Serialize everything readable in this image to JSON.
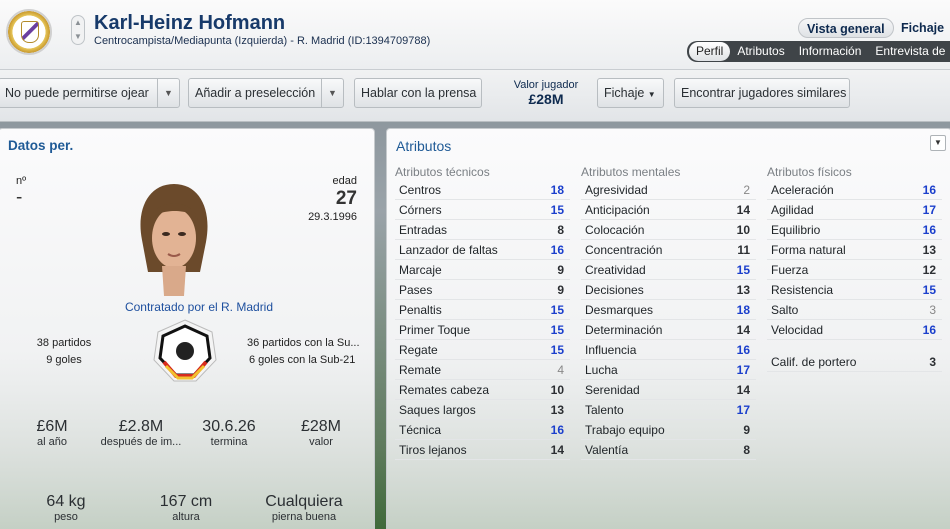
{
  "header": {
    "name": "Karl-Heinz Hofmann",
    "info": "Centrocampista/Mediapunta (Izquierda) - R. Madrid (ID:1394709788)",
    "views": [
      "Vista general",
      "Fichaje"
    ],
    "tabs": [
      "Perfil",
      "Atributos",
      "Información",
      "Entrevista de"
    ]
  },
  "toolbar": {
    "scout": "No puede permitirse ojear",
    "shortlist": "Añadir a preselección",
    "press": "Hablar con la prensa",
    "value_label": "Valor jugador",
    "value": "£28M",
    "transfer": "Fichaje",
    "similar": "Encontrar jugadores similares"
  },
  "personal": {
    "title": "Datos per.",
    "number_label": "nº",
    "number": "-",
    "age_label": "edad",
    "age": "27",
    "dob": "29.3.1996",
    "contract": "Contratado por el R. Madrid",
    "caps": "38 partidos",
    "goals": "9 goles",
    "u21_caps": "36 partidos con la Su...",
    "u21_goals": "6 goles con la Sub-21",
    "wage": "£6M",
    "wage_l": "al año",
    "after": "£2.8M",
    "after_l": "después de im...",
    "expires": "30.6.26",
    "expires_l": "termina",
    "value": "£28M",
    "value_l": "valor",
    "weight": "64 kg",
    "weight_l": "peso",
    "height": "167 cm",
    "height_l": "altura",
    "foot": "Cualquiera",
    "foot_l": "pierna buena"
  },
  "attributes": {
    "title": "Atributos",
    "technical": {
      "heading": "Atributos técnicos",
      "items": [
        [
          "Centros",
          18
        ],
        [
          "Córners",
          15
        ],
        [
          "Entradas",
          8
        ],
        [
          "Lanzador de faltas",
          16
        ],
        [
          "Marcaje",
          9
        ],
        [
          "Pases",
          9
        ],
        [
          "Penaltis",
          15
        ],
        [
          "Primer Toque",
          15
        ],
        [
          "Regate",
          15
        ],
        [
          "Remate",
          4
        ],
        [
          "Remates cabeza",
          10
        ],
        [
          "Saques largos",
          13
        ],
        [
          "Técnica",
          16
        ],
        [
          "Tiros lejanos",
          14
        ]
      ]
    },
    "mental": {
      "heading": "Atributos mentales",
      "items": [
        [
          "Agresividad",
          2
        ],
        [
          "Anticipación",
          14
        ],
        [
          "Colocación",
          10
        ],
        [
          "Concentración",
          11
        ],
        [
          "Creatividad",
          15
        ],
        [
          "Decisiones",
          13
        ],
        [
          "Desmarques",
          18
        ],
        [
          "Determinación",
          14
        ],
        [
          "Influencia",
          16
        ],
        [
          "Lucha",
          17
        ],
        [
          "Serenidad",
          14
        ],
        [
          "Talento",
          17
        ],
        [
          "Trabajo equipo",
          9
        ],
        [
          "Valentía",
          8
        ]
      ]
    },
    "physical": {
      "heading": "Atributos físicos",
      "items": [
        [
          "Aceleración",
          16
        ],
        [
          "Agilidad",
          17
        ],
        [
          "Equilibrio",
          16
        ],
        [
          "Forma natural",
          13
        ],
        [
          "Fuerza",
          12
        ],
        [
          "Resistencia",
          15
        ],
        [
          "Salto",
          3
        ],
        [
          "Velocidad",
          16
        ]
      ],
      "gk_label": "Calif. de portero",
      "gk": 3
    }
  }
}
